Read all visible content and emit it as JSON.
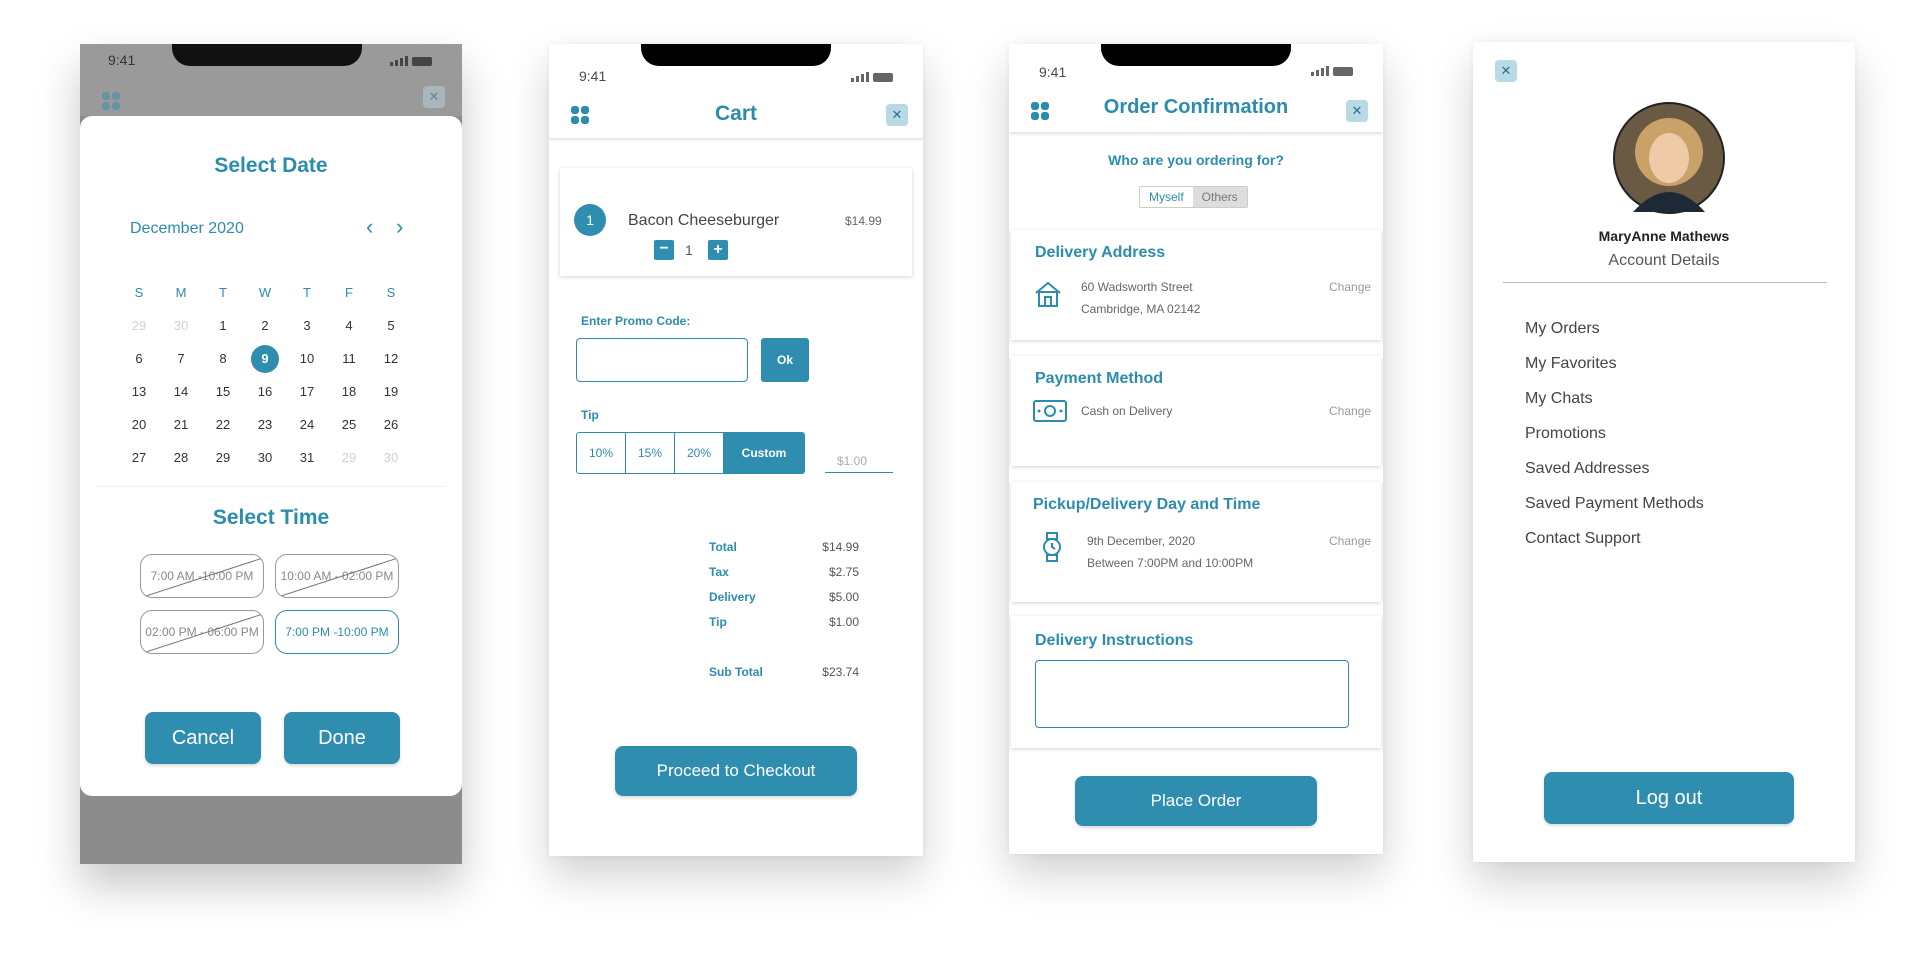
{
  "date_screen": {
    "status_time": "9:41",
    "title": "Select Date",
    "month": "December 2020",
    "weekdays": [
      "S",
      "M",
      "T",
      "W",
      "T",
      "F",
      "S"
    ],
    "weeks": [
      [
        "29",
        "30",
        "1",
        "2",
        "3",
        "4",
        "5"
      ],
      [
        "6",
        "7",
        "8",
        "9",
        "10",
        "11",
        "12"
      ],
      [
        "13",
        "14",
        "15",
        "16",
        "17",
        "18",
        "19"
      ],
      [
        "20",
        "21",
        "22",
        "23",
        "24",
        "25",
        "26"
      ],
      [
        "27",
        "28",
        "29",
        "30",
        "31",
        "29",
        "30"
      ]
    ],
    "selected_day": "9",
    "time_title": "Select Time",
    "slots": [
      "7:00 AM -10:00 PM",
      "10:00 AM - 02:00 PM",
      "02:00 PM - 06:00 PM",
      "7:00 PM -10:00 PM"
    ],
    "cancel_label": "Cancel",
    "done_label": "Done"
  },
  "cart_screen": {
    "status_time": "9:41",
    "title": "Cart",
    "item": {
      "index": "1",
      "name": "Bacon Cheeseburger",
      "price": "$14.99",
      "qty": "1"
    },
    "promo_label": "Enter Promo Code:",
    "promo_value": "",
    "ok_label": "Ok",
    "tip_label": "Tip",
    "tip_options": [
      "10%",
      "15%",
      "20%",
      "Custom"
    ],
    "tip_placeholder": "$1.00",
    "summary": [
      {
        "label": "Total",
        "value": "$14.99"
      },
      {
        "label": "Tax",
        "value": "$2.75"
      },
      {
        "label": "Delivery",
        "value": "$5.00"
      },
      {
        "label": "Tip",
        "value": "$1.00"
      },
      {
        "label": "Sub Total",
        "value": "$23.74"
      }
    ],
    "checkout_label": "Proceed to Checkout"
  },
  "order_screen": {
    "status_time": "9:41",
    "title": "Order Confirmation",
    "question": "Who are you ordering for?",
    "seg_myself": "Myself",
    "seg_others": "Others",
    "address_title": "Delivery Address",
    "address_line1": "60 Wadsworth Street",
    "address_line2": "Cambridge, MA 02142",
    "payment_title": "Payment Method",
    "payment_value": "Cash on Delivery",
    "time_title": "Pickup/Delivery Day and Time",
    "time_line1": "9th December, 2020",
    "time_line2": "Between 7:00PM and 10:00PM",
    "change_label": "Change",
    "instructions_title": "Delivery Instructions",
    "place_order_label": "Place Order"
  },
  "account_screen": {
    "user_name": "MaryAnne Mathews",
    "subtitle": "Account Details",
    "menu": [
      "My Orders",
      "My Favorites",
      "My Chats",
      "Promotions",
      "Saved Addresses",
      "Saved Payment Methods",
      "Contact Support"
    ],
    "logout_label": "Log out"
  },
  "colors": {
    "accent": "#2f8db0",
    "accent_light": "#b7dae6",
    "overlay": "#8c8c8c"
  }
}
